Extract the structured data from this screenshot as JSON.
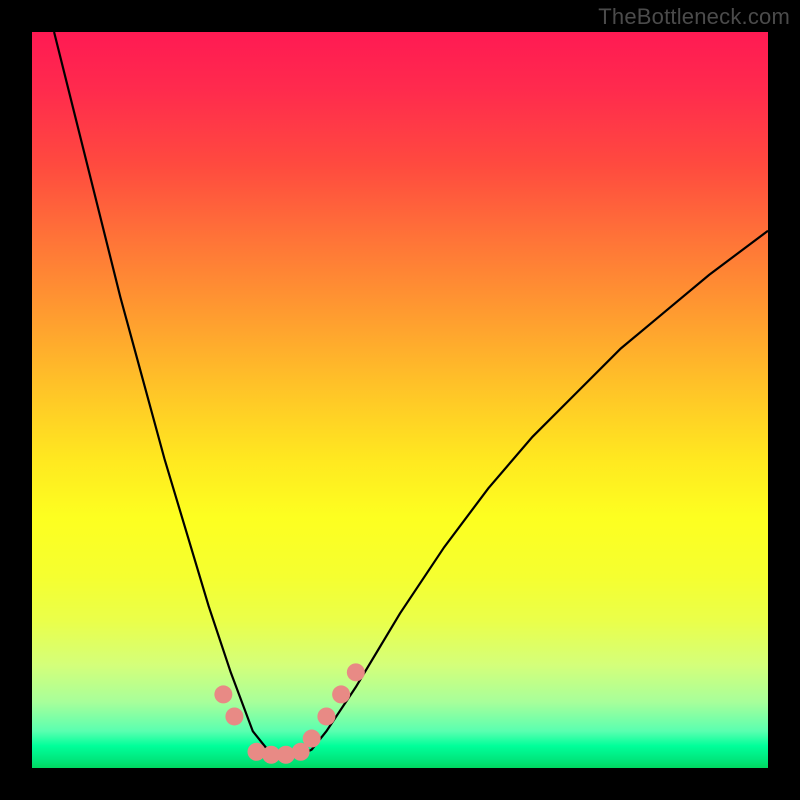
{
  "watermark": "TheBottleneck.com",
  "chart_data": {
    "type": "line",
    "title": "",
    "xlabel": "",
    "ylabel": "",
    "xlim": [
      0,
      100
    ],
    "ylim": [
      0,
      100
    ],
    "series": [
      {
        "name": "bottleneck-curve",
        "x": [
          3,
          6,
          9,
          12,
          15,
          18,
          21,
          24,
          27,
          28.5,
          30,
          32,
          34,
          36,
          38,
          40,
          44,
          50,
          56,
          62,
          68,
          74,
          80,
          86,
          92,
          100
        ],
        "y": [
          100,
          88,
          76,
          64,
          53,
          42,
          32,
          22,
          13,
          9,
          5,
          2.5,
          1.5,
          1.5,
          2.5,
          5,
          11,
          21,
          30,
          38,
          45,
          51,
          57,
          62,
          67,
          73
        ]
      }
    ],
    "markers": [
      {
        "name": "left-marker-1",
        "x": 26,
        "y": 10
      },
      {
        "name": "left-marker-2",
        "x": 27.5,
        "y": 7
      },
      {
        "name": "right-marker-1",
        "x": 38,
        "y": 4
      },
      {
        "name": "right-marker-2",
        "x": 40,
        "y": 7
      },
      {
        "name": "right-marker-3",
        "x": 42,
        "y": 10
      },
      {
        "name": "right-marker-4",
        "x": 44,
        "y": 13
      },
      {
        "name": "bottom-marker-1",
        "x": 30.5,
        "y": 2.2
      },
      {
        "name": "bottom-marker-2",
        "x": 32.5,
        "y": 1.8
      },
      {
        "name": "bottom-marker-3",
        "x": 34.5,
        "y": 1.8
      },
      {
        "name": "bottom-marker-4",
        "x": 36.5,
        "y": 2.2
      }
    ],
    "marker_color": "#e88a85",
    "curve_color": "#000000"
  }
}
